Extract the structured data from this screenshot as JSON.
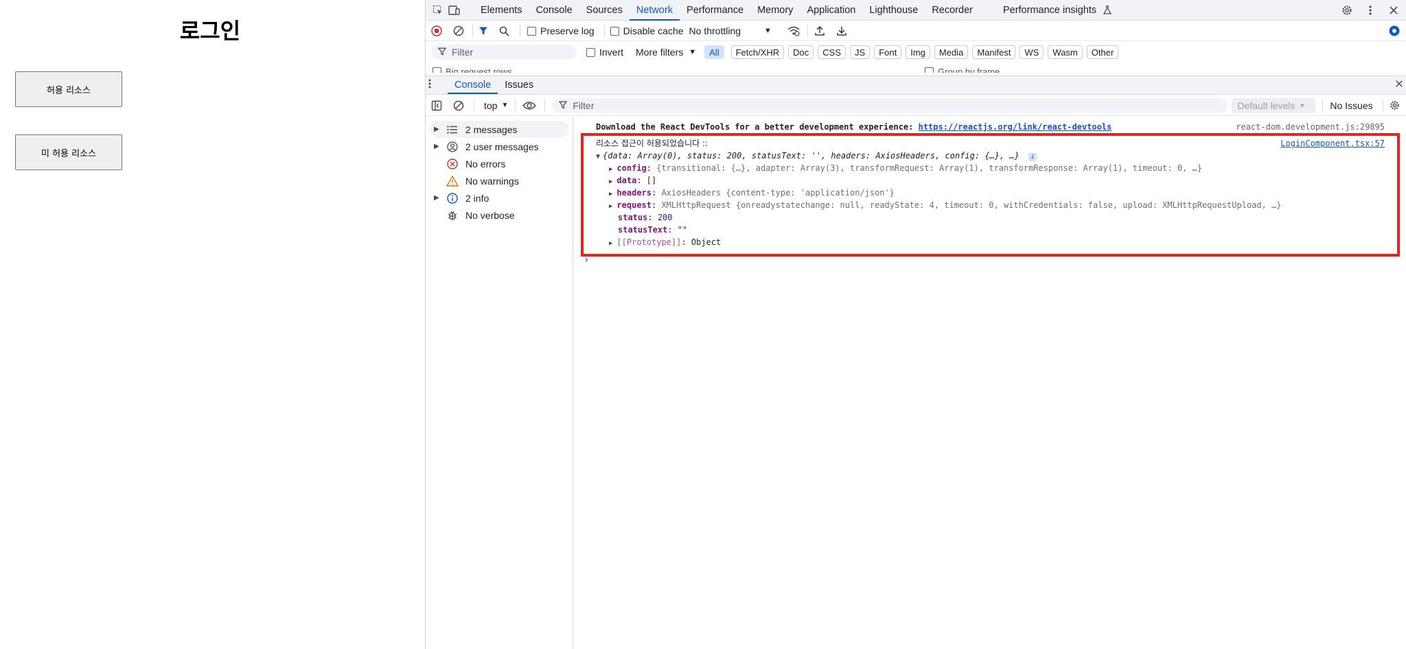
{
  "page": {
    "title": "로그인",
    "button_allowed": "허용 리소스",
    "button_denied": "미 허용 리소스"
  },
  "devtools": {
    "main_tabs": [
      "Elements",
      "Console",
      "Sources",
      "Network",
      "Performance",
      "Memory",
      "Application",
      "Lighthouse",
      "Recorder",
      "Performance insights"
    ],
    "active_main_tab": "Network",
    "network_toolbar": {
      "preserve_log": "Preserve log",
      "disable_cache": "Disable cache",
      "throttling": "No throttling"
    },
    "filter_row": {
      "filter_placeholder": "Filter",
      "invert": "Invert",
      "more_filters": "More filters",
      "types": [
        "All",
        "Fetch/XHR",
        "Doc",
        "CSS",
        "JS",
        "Font",
        "Img",
        "Media",
        "Manifest",
        "WS",
        "Wasm",
        "Other"
      ]
    },
    "clipped_row": {
      "big_request_rows": "Big request rows",
      "group_by_frame": "Group by frame"
    },
    "drawer_tabs": [
      "Console",
      "Issues"
    ],
    "console_toolbar": {
      "context": "top",
      "filter_placeholder": "Filter",
      "levels": "Default levels",
      "issues": "No Issues"
    },
    "sidebar": [
      {
        "label": "2 messages",
        "icon": "list-icon",
        "expandable": true
      },
      {
        "label": "2 user messages",
        "icon": "user-icon",
        "expandable": true
      },
      {
        "label": "No errors",
        "icon": "error-icon",
        "expandable": false
      },
      {
        "label": "No warnings",
        "icon": "warning-icon",
        "expandable": false
      },
      {
        "label": "2 info",
        "icon": "info-icon",
        "expandable": true
      },
      {
        "label": "No verbose",
        "icon": "bug-icon",
        "expandable": false
      }
    ],
    "console": {
      "react_msg": "Download the React DevTools for a better development experience: ",
      "react_link": "https://reactjs.org/link/react-devtools",
      "react_src": "react-dom.development.js:29895",
      "log_title": "리소스 접근이 허용되었습니다 ::",
      "log_src": "LoginComponent.tsx:57",
      "summary": "{data: Array(0), status: 200, statusText: '', headers: AxiosHeaders, config: {…}, …}",
      "config_key": "config",
      "config_val": "{transitional: {…}, adapter: Array(3), transformRequest: Array(1), transformResponse: Array(1), timeout: 0, …}",
      "data_key": "data",
      "data_val": "[]",
      "headers_key": "headers",
      "headers_val": "AxiosHeaders {content-type: 'application/json'}",
      "request_key": "request",
      "request_val": "XMLHttpRequest {onreadystatechange: null, readyState: 4, timeout: 0, withCredentials: false, upload: XMLHttpRequestUpload, …}",
      "status_key": "status",
      "status_val": "200",
      "statustext_key": "statusText",
      "statustext_val": "\"\"",
      "proto_key": "[[Prototype]]",
      "proto_val": "Object",
      "prompt": "›"
    }
  }
}
